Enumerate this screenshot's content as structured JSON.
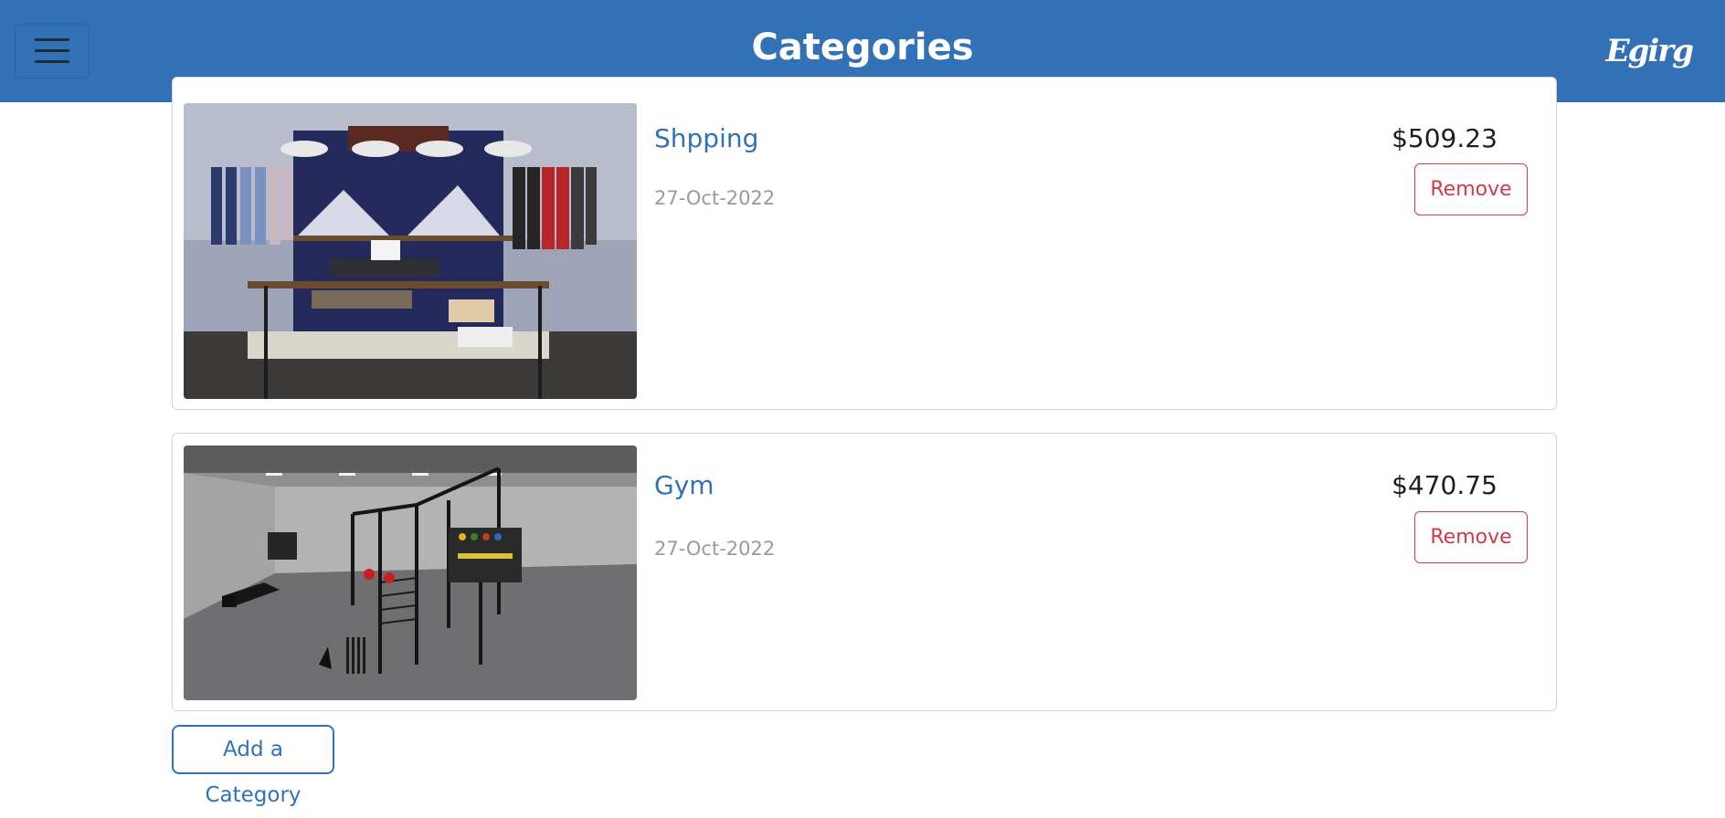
{
  "header": {
    "title": "Categories",
    "logo_text": "Egirg",
    "menu_icon": "hamburger-menu-icon",
    "background_color": "#3371b7"
  },
  "categories": [
    {
      "name": "Shpping",
      "date": "27-Oct-2022",
      "amount": "$509.23",
      "remove_label": "Remove",
      "image_subject": "clothing store interior"
    },
    {
      "name": "Gym",
      "date": "27-Oct-2022",
      "amount": "$470.75",
      "remove_label": "Remove",
      "image_subject": "gym with rigs and weights"
    }
  ],
  "add_button": {
    "label": "Add a Category"
  },
  "colors": {
    "accent": "#3371b7",
    "danger": "#d13a4a",
    "muted_text": "#9a9a9a"
  }
}
